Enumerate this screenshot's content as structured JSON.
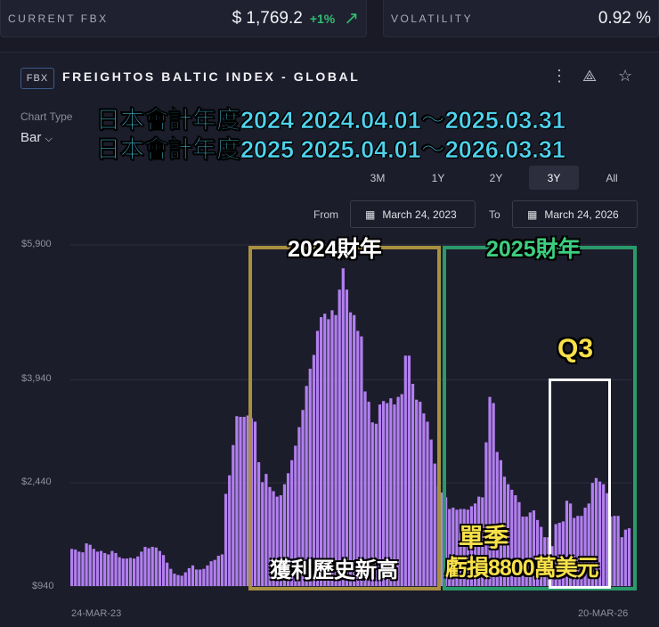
{
  "stats": {
    "current_label": "CURRENT FBX",
    "current_value": "$ 1,769.2",
    "current_change": "+1%",
    "volatility_label": "VOLATILITY",
    "volatility_value": "0.92 %"
  },
  "header": {
    "badge": "FBX",
    "title": "FREIGHTOS BALTIC INDEX - GLOBAL"
  },
  "chart_type": {
    "label": "Chart Type",
    "value": "Bar"
  },
  "overlay": {
    "line1": "日本會計年度2024 2024.04.01～2025.03.31",
    "line2": "日本會計年度2025 2025.04.01～2026.03.31"
  },
  "ranges": [
    {
      "label": "3M"
    },
    {
      "label": "1Y"
    },
    {
      "label": "2Y"
    },
    {
      "label": "3Y",
      "selected": true
    },
    {
      "label": "All"
    }
  ],
  "dates": {
    "from_label": "From",
    "from": "March 24, 2023",
    "to_label": "To",
    "to": "March 24, 2026"
  },
  "annotations": {
    "fy2024": "2024財年",
    "fy2025": "2025財年",
    "q3": "Q3",
    "quarter": "單季",
    "loss": "虧損8800萬美元",
    "record": "獲利歷史新高"
  },
  "colors": {
    "bar": "#b27ff0",
    "fy2024": "#a89040",
    "fy2025": "#2a9a6a",
    "q3": "#ffffff",
    "ann_yellow": "#f7e04a",
    "ann_green": "#3ccf7f"
  },
  "chart_data": {
    "type": "bar",
    "title": "Freightos Baltic Index - Global",
    "ylim": [
      940,
      5900
    ],
    "yticks": [
      "$940",
      "$2,440",
      "$3,940",
      "$5,900"
    ],
    "ytick_values": [
      940,
      2440,
      3940,
      5900
    ],
    "xticks": [
      "24-MAR-23",
      "20-MAR-26"
    ],
    "values": [
      1480,
      1470,
      1440,
      1430,
      1560,
      1540,
      1480,
      1440,
      1450,
      1420,
      1400,
      1450,
      1420,
      1360,
      1340,
      1340,
      1350,
      1340,
      1370,
      1440,
      1510,
      1490,
      1510,
      1500,
      1450,
      1390,
      1280,
      1190,
      1120,
      1100,
      1090,
      1140,
      1200,
      1240,
      1180,
      1180,
      1190,
      1240,
      1300,
      1320,
      1380,
      1400,
      2280,
      2550,
      2990,
      3410,
      3400,
      3400,
      3420,
      3380,
      3330,
      2740,
      2450,
      2570,
      2380,
      2320,
      2240,
      2260,
      2420,
      2580,
      2770,
      2980,
      3250,
      3500,
      3850,
      4100,
      4300,
      4650,
      4850,
      4900,
      4820,
      4950,
      4880,
      5250,
      5560,
      5250,
      4920,
      4880,
      4650,
      4570,
      3770,
      3620,
      3320,
      3300,
      3580,
      3630,
      3600,
      3670,
      3580,
      3690,
      3730,
      4290,
      4290,
      3880,
      3650,
      3620,
      3450,
      3330,
      3070,
      2720,
      2400,
      2300,
      2230,
      2060,
      2080,
      2050,
      2060,
      2060,
      2050,
      2100,
      2140,
      2240,
      2230,
      3030,
      3690,
      3600,
      2890,
      2770,
      2530,
      2420,
      2340,
      2260,
      2160,
      1950,
      1950,
      2010,
      2040,
      1900,
      1800,
      1650,
      1650,
      1520,
      1840,
      1860,
      1880,
      2180,
      2140,
      1930,
      1960,
      1960,
      2080,
      2140,
      2440,
      2510,
      2460,
      2420,
      2290,
      1950,
      1960,
      1960,
      1650,
      1760,
      1780
    ]
  }
}
